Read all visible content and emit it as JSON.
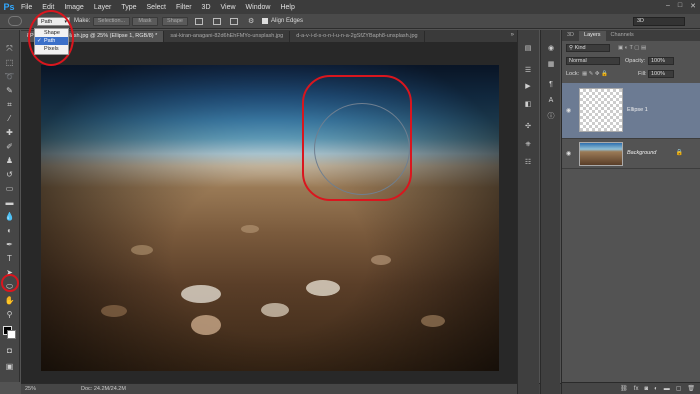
{
  "menubar": {
    "logo": "Ps",
    "items": [
      "File",
      "Edit",
      "Image",
      "Layer",
      "Type",
      "Select",
      "Filter",
      "3D",
      "View",
      "Window",
      "Help"
    ],
    "window_controls": [
      "–",
      "□",
      "✕"
    ]
  },
  "options": {
    "mode_value": "Path",
    "make_label": "Make:",
    "selection_label": "Selection...",
    "mask_label": "Mask",
    "shape_label": "Shape",
    "align_edges_label": "Align Edges",
    "workspace_value": "3D"
  },
  "dropdown": {
    "items": [
      "Shape",
      "Path",
      "Pixels"
    ],
    "selected_index": 1
  },
  "tabs": [
    "8P3A9XmU-unsplash.jpg @ 25% (Ellipse 1, RGB/8) *",
    "sai-kiran-anagani-82d6hEhFMYo-unsplash.jpg",
    "d-a-v-i-d-s-o-n-l-u-n-a-2gSfZYBaph8-unsplash.jpg"
  ],
  "tabs_more": "»",
  "status": {
    "zoom": "25%",
    "doc": "Doc: 24.2M/24.2M"
  },
  "panel": {
    "tabs": [
      "3D",
      "Layers",
      "Channels"
    ],
    "active_tab": 1,
    "kind_label": "Kind",
    "blend_mode": "Normal",
    "opacity_label": "Opacity:",
    "opacity_value": "100%",
    "lock_label": "Lock:",
    "fill_label": "Fill:",
    "fill_value": "100%",
    "layers": [
      {
        "name": "Ellipse 1",
        "selected": true
      },
      {
        "name": "Background",
        "selected": false,
        "locked": true
      }
    ],
    "footer_icons": [
      "link-icon",
      "fx-icon",
      "mask-icon",
      "adjustment-icon",
      "folder-icon",
      "new-layer-icon",
      "trash-icon"
    ]
  },
  "colors": {
    "highlight_red": "#d9161e",
    "selection_blue": "#3b70c9",
    "layer_selected": "#6c7b93"
  }
}
